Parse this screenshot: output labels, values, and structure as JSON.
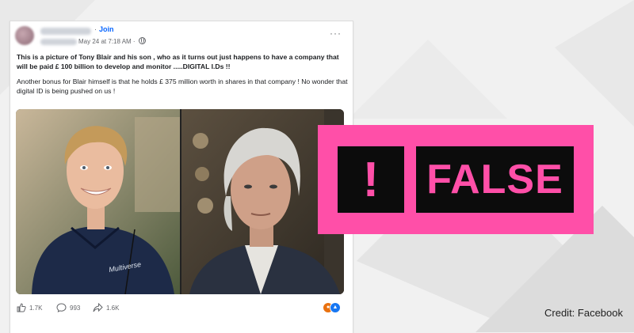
{
  "post": {
    "join_label": "Join",
    "separator": "·",
    "timestamp": "May 24 at 7:18 AM ·",
    "more_label": "···",
    "text_bold": "This is a picture of Tony Blair and his son , who as it turns out just happens to have a company that will be paid £ 100 billion to develop and monitor .....DIGITAL I.Ds !!",
    "text_regular": "Another bonus for Blair himself is that he holds £ 375 million worth in shares in that company ! No wonder that digital ID is being pushed on us !",
    "shirt_logo": "Multiverse",
    "likes": "1.7K",
    "comments": "993",
    "shares": "1.6K",
    "icons": [
      "globe-icon",
      "more-icon",
      "like-icon",
      "comment-icon",
      "share-icon",
      "angry-reaction-icon",
      "like-reaction-icon"
    ]
  },
  "badge": {
    "exclamation": "!",
    "verdict": "FALSE",
    "color": "#ff4fa8",
    "box_color": "#0c0c0c"
  },
  "credit": "Credit: Facebook"
}
